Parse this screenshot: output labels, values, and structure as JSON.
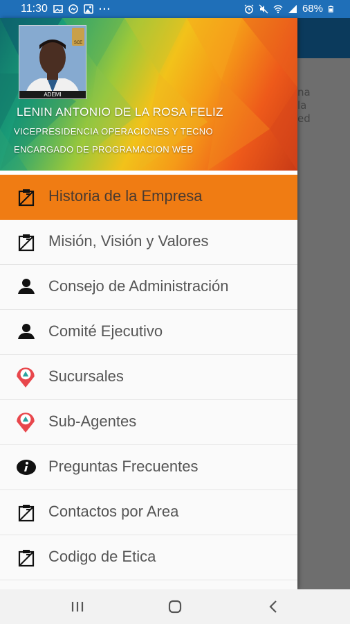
{
  "status_bar": {
    "time": "11:30",
    "more": "···",
    "battery": "68%",
    "icons": [
      "gallery-icon",
      "messenger-icon",
      "image-icon",
      "alarm-icon",
      "mute-icon",
      "wifi-icon",
      "signal-icon",
      "battery-icon"
    ]
  },
  "profile": {
    "name": "LENIN ANTONIO DE LA ROSA FELIZ",
    "department": "VICEPRESIDENCIA OPERACIONES Y TECNO",
    "role": "ENCARGADO DE PROGRAMACION WEB",
    "photo_caption": "ADEMI",
    "badge_text": "SCE"
  },
  "menu": {
    "items": [
      {
        "label": "Historia de la Empresa",
        "icon": "clipboard-icon",
        "active": true
      },
      {
        "label": "Misión, Visión y Valores",
        "icon": "clipboard-icon",
        "active": false
      },
      {
        "label": "Consejo de Administración",
        "icon": "person-icon",
        "active": false
      },
      {
        "label": "Comité Ejecutivo",
        "icon": "person-icon",
        "active": false
      },
      {
        "label": "Sucursales",
        "icon": "map-pin-icon",
        "active": false
      },
      {
        "label": "Sub-Agentes",
        "icon": "map-pin-icon",
        "active": false
      },
      {
        "label": "Preguntas Frecuentes",
        "icon": "info-icon",
        "active": false
      },
      {
        "label": "Contactos por Area",
        "icon": "clipboard-icon",
        "active": false
      },
      {
        "label": "Codigo de Etica",
        "icon": "clipboard-icon",
        "active": false
      }
    ]
  },
  "background_app": {
    "snippet": [
      "na",
      "la",
      "ed"
    ]
  },
  "colors": {
    "status_bar": "#1f6fb8",
    "active_item": "#f07c13",
    "app_bar": "#0b3a5c",
    "pin": "#e8474c"
  },
  "nav_bar": {
    "buttons": [
      "recent-apps-icon",
      "home-icon",
      "back-icon"
    ]
  }
}
